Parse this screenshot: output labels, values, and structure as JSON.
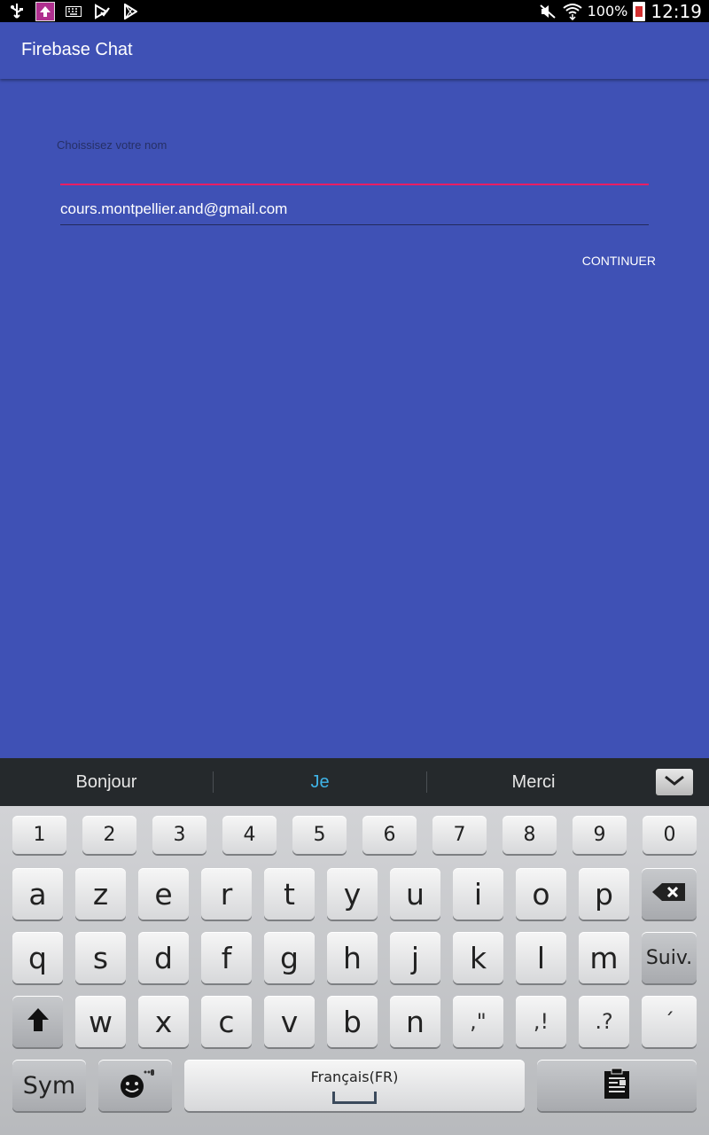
{
  "status_bar": {
    "left_icons": [
      "usb-icon",
      "upload-notification-icon",
      "keyboard-icon",
      "play-store-check-icon",
      "play-store-icon"
    ],
    "battery_percent": "100%",
    "time": "12:19",
    "right_icons": [
      "mute-icon",
      "wifi-icon",
      "battery-icon"
    ]
  },
  "app_bar": {
    "title": "Firebase Chat"
  },
  "form": {
    "name_label": "Choissisez votre nom",
    "name_value": "",
    "email_value": "cours.montpellier.and@gmail.com",
    "continue_label": "CONTINUER"
  },
  "suggestions": {
    "items": [
      "Bonjour",
      "Je",
      "Merci"
    ],
    "active_index": 1
  },
  "keyboard": {
    "number_row": [
      "1",
      "2",
      "3",
      "4",
      "5",
      "6",
      "7",
      "8",
      "9",
      "0"
    ],
    "row1": [
      "a",
      "z",
      "e",
      "r",
      "t",
      "y",
      "u",
      "i",
      "o",
      "p"
    ],
    "row2": [
      "q",
      "s",
      "d",
      "f",
      "g",
      "h",
      "j",
      "k",
      "l",
      "m"
    ],
    "row2_action": "Suiv.",
    "row3": [
      "w",
      "x",
      "c",
      "v",
      "b",
      "n"
    ],
    "row3_punct": [
      ",\"",
      ",!",
      ".?",
      "´"
    ],
    "sym_label": "Sym",
    "space_label": "Français(FR)"
  },
  "colors": {
    "primary": "#3f51b5",
    "accent_underline": "#e91e63",
    "suggestion_active": "#3fb4e8"
  }
}
